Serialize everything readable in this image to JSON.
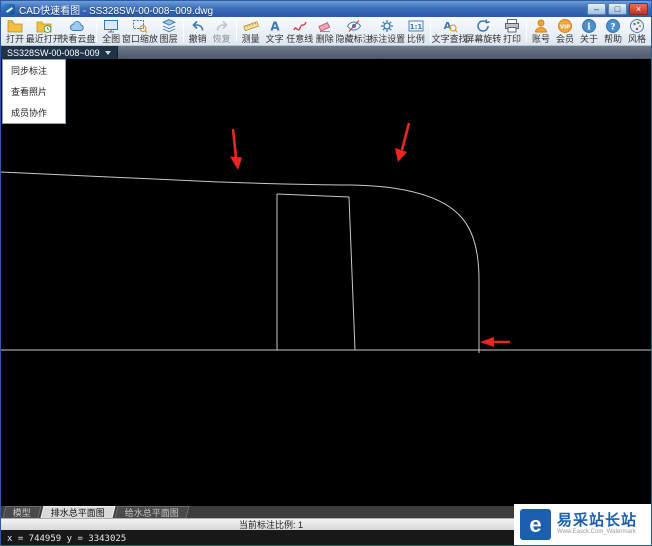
{
  "window": {
    "title": "CAD快速看图 - SS328SW-00-008~009.dwg",
    "minimize": "–",
    "maximize": "□",
    "close": "×"
  },
  "toolbar": {
    "items": [
      {
        "label": "打开"
      },
      {
        "label": "最近打开"
      },
      {
        "label": "快看云盘"
      },
      {
        "label": "全图"
      },
      {
        "label": "窗口缩放"
      },
      {
        "label": "图层"
      },
      {
        "label": "撤销"
      },
      {
        "label": "恢复"
      },
      {
        "label": "测量"
      },
      {
        "label": "文字"
      },
      {
        "label": "任意线"
      },
      {
        "label": "删除"
      },
      {
        "label": "隐藏标注"
      },
      {
        "label": "标注设置"
      },
      {
        "label": "比例"
      },
      {
        "label": "文字查找"
      },
      {
        "label": "屏幕旋转"
      },
      {
        "label": "打印"
      },
      {
        "label": "账号"
      },
      {
        "label": "会员"
      },
      {
        "label": "关于"
      },
      {
        "label": "帮助"
      },
      {
        "label": "风格"
      }
    ],
    "icon_glyphs": {
      "text": "A",
      "scale": "1:1",
      "find": "A",
      "vip": "VIP",
      "about": "i",
      "help": "?"
    }
  },
  "doc_tab": {
    "label": "SS328SW-00-008~009"
  },
  "context_menu": {
    "items": [
      {
        "label": "同步标注"
      },
      {
        "label": "查看照片"
      },
      {
        "label": "成员协作"
      }
    ]
  },
  "sheet_bar": {
    "tabs": [
      {
        "label": "模型"
      },
      {
        "label": "排水总平面图"
      },
      {
        "label": "给水总平面图"
      }
    ]
  },
  "status_bar": {
    "scale_text": "当前标注比例: 1"
  },
  "coord_bar": {
    "coords_text": "x = 744959  y = 3343025"
  },
  "watermark": {
    "logo_letter": "e",
    "title": "易采站长站",
    "subtitle": "Www.Easck.Com_Watermark"
  },
  "colors": {
    "titlebar_blue": "#3a6db8",
    "canvas_background": "#000000",
    "cad_line": "#c9c9c9",
    "annotation_arrow_red": "#e8281e",
    "watermark_blue": "#1b5fae"
  }
}
